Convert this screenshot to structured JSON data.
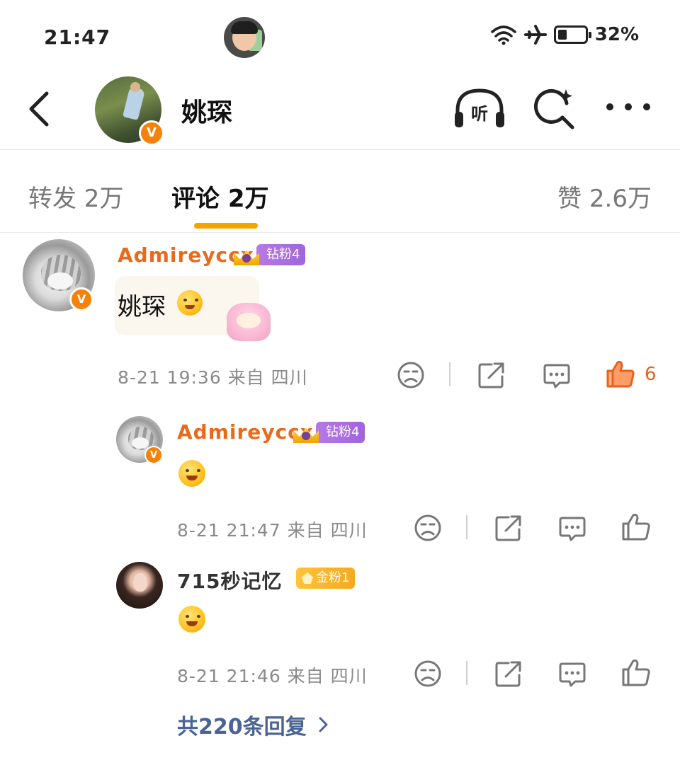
{
  "status_bar": {
    "time": "21:47",
    "battery": "32%",
    "battery_level": 0.32
  },
  "header": {
    "title": "姚琛",
    "listen_label": "听"
  },
  "tabs": [
    {
      "label": "转发 2万"
    },
    {
      "label": "评论 2万"
    },
    {
      "label": "赞 2.6万"
    }
  ],
  "comment": {
    "username": "Admireyccx",
    "fan_badge": "钻粉4",
    "text": "姚琛",
    "meta": "8-21 19:36 来自 四川",
    "likes": "6",
    "replies": [
      {
        "username": "Admireyccx",
        "fan_badge": "钻粉4",
        "meta": "8-21 21:47 来自 四川"
      },
      {
        "username": "715秒记忆",
        "fan_badge": "金粉1",
        "meta": "8-21 21:46 来自 四川"
      }
    ],
    "more_replies": "共220条回复"
  },
  "colors": {
    "accent": "#f5a300",
    "username_orange": "#e86a1a",
    "link_blue": "#4a6494"
  }
}
